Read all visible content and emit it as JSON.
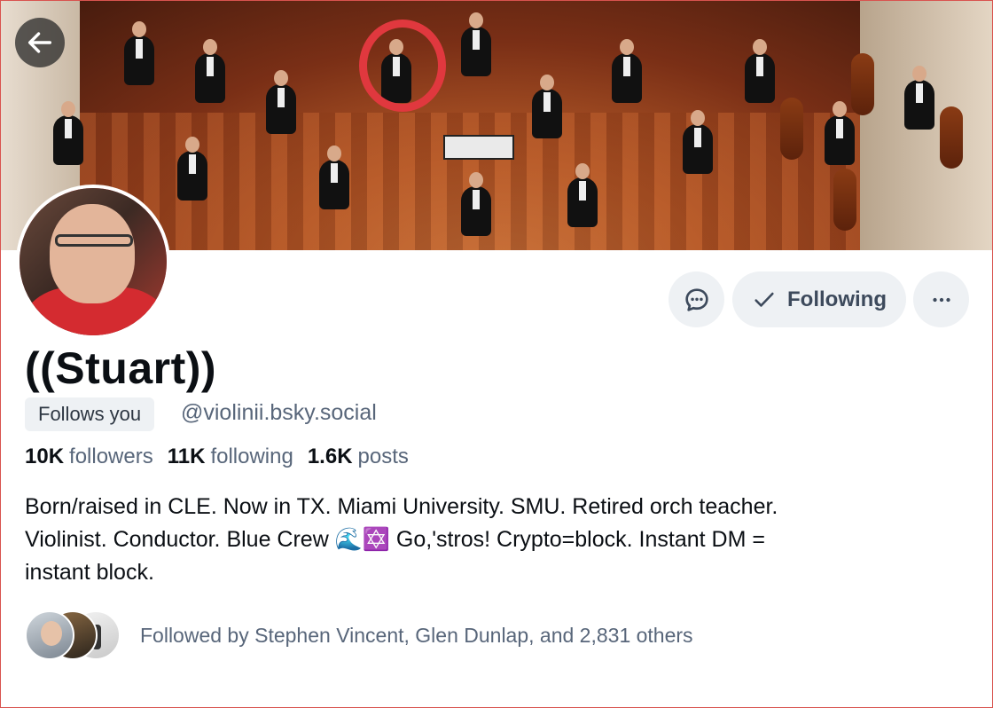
{
  "profile": {
    "display_name": "((Stuart))",
    "follows_you_label": "Follows you",
    "handle": "@violinii.bsky.social",
    "stats": {
      "followers_count": "10K",
      "followers_label": "followers",
      "following_count": "11K",
      "following_label": "following",
      "posts_count": "1.6K",
      "posts_label": "posts"
    },
    "bio_line1": "Born/raised in CLE. Now in TX. Miami University. SMU. Retired orch teacher.",
    "bio_line2": "Violinist. Conductor. Blue Crew 🌊✡️  Go,'stros! Crypto=block. Instant DM =",
    "bio_line3": "instant block.",
    "followed_by": "Followed by Stephen Vincent, Glen Dunlap, and 2,831 others"
  },
  "actions": {
    "following_label": "Following",
    "following_icon": "checkmark-icon",
    "message_icon": "chat-bubble-icon",
    "more_icon": "ellipsis-icon",
    "back_icon": "arrow-left-icon"
  },
  "colors": {
    "accent_mark": "#e0383e",
    "button_bg": "#eef1f4",
    "muted_text": "#58667a"
  }
}
